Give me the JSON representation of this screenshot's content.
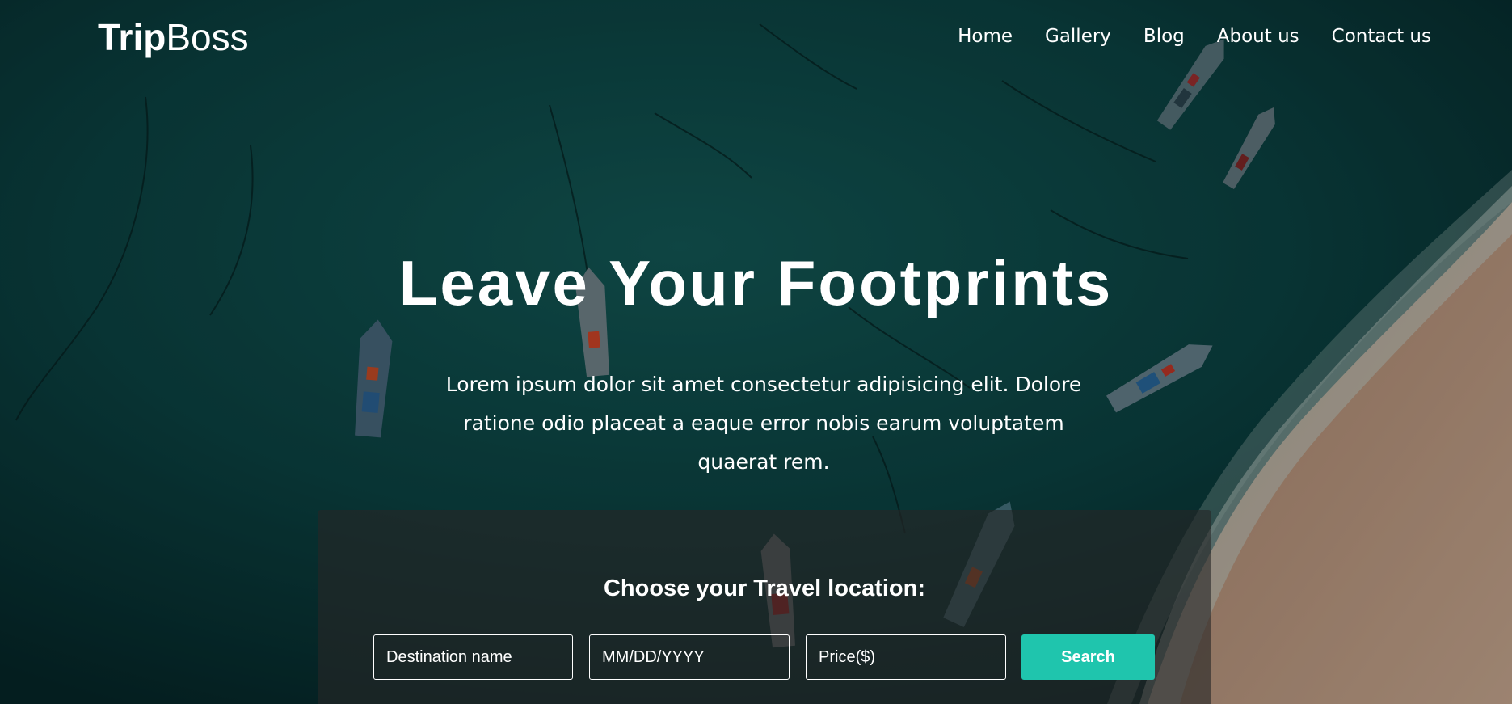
{
  "brand": {
    "name_bold": "Trip",
    "name_light": "Boss"
  },
  "nav": {
    "items": [
      "Home",
      "Gallery",
      "Blog",
      "About us",
      "Contact us"
    ]
  },
  "hero": {
    "title": "Leave Your Footprints",
    "subtitle": "Lorem ipsum dolor sit amet consectetur adipisicing elit. Dolore ratione odio placeat a eaque error nobis earum voluptatem quaerat rem.",
    "background_description_icon": "aerial-beach-boats-image"
  },
  "search": {
    "heading": "Choose your Travel location:",
    "destination_placeholder": "Destination name",
    "date_placeholder": "MM/DD/YYYY",
    "price_placeholder": "Price($)",
    "button_label": "Search"
  },
  "colors": {
    "accent": "#1fc5ad",
    "sea": "#0b3e3f",
    "panel": "#262626"
  }
}
